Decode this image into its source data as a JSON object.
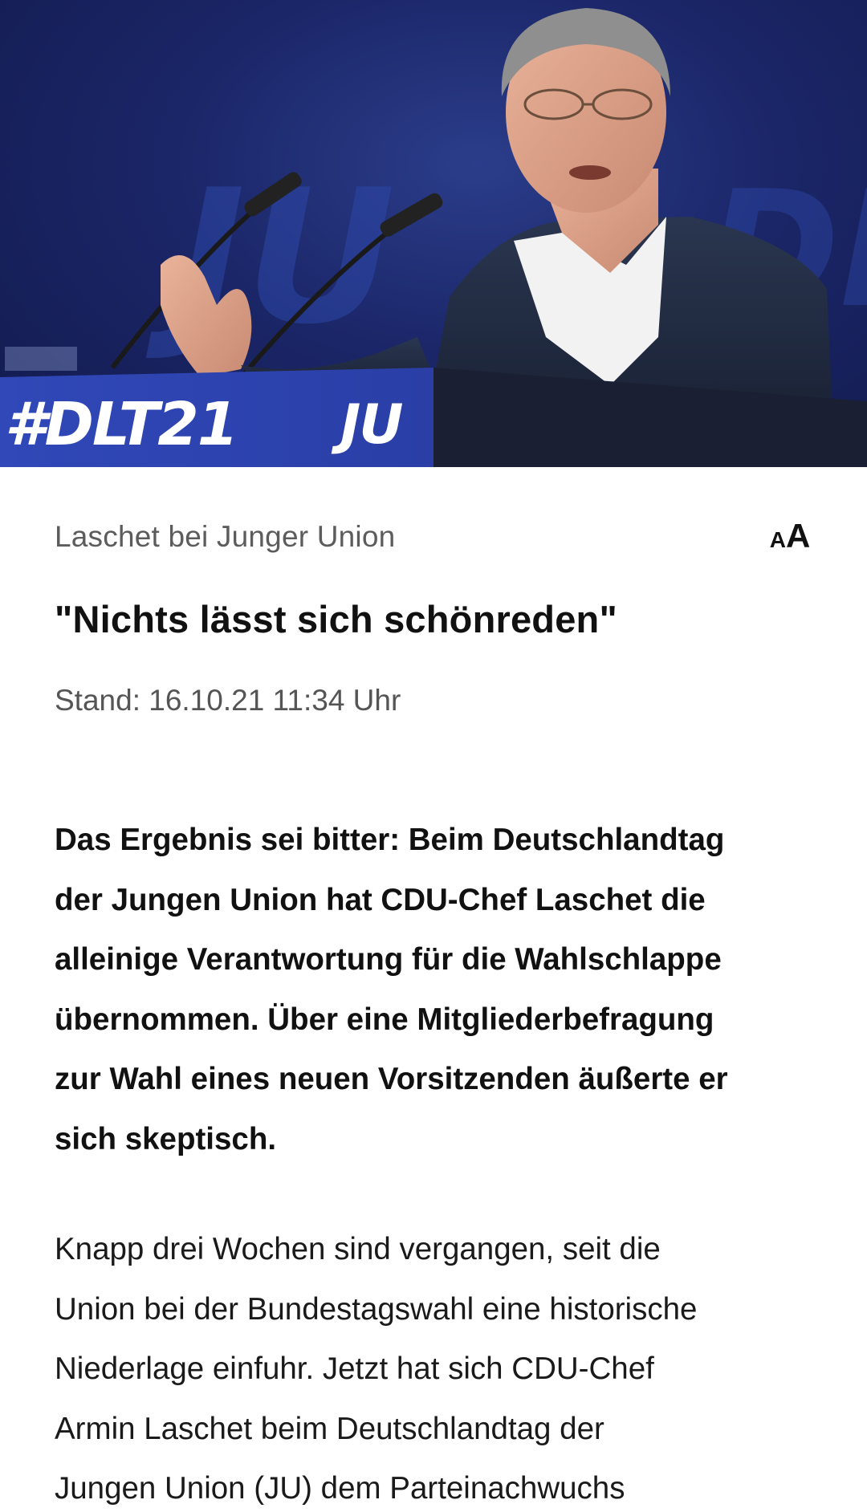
{
  "hero": {
    "lectern_hashtag": "#DLT21",
    "lectern_logo": "JU",
    "backdrop_logo": "JU DLT"
  },
  "article": {
    "topline": "Laschet bei Junger Union",
    "font_size_button": {
      "small": "A",
      "large": "A"
    },
    "headline": "\"Nichts lässt sich schönreden\"",
    "dateline": "Stand: 16.10.21 11:34 Uhr",
    "teaser_lines": [
      "Das Ergebnis sei bitter: Beim Deutschlandtag",
      "der Jungen Union hat CDU-Chef Laschet die",
      "alleinige Verantwortung für die Wahlschlappe",
      "übernommen. Über eine Mitgliederbefragung",
      "zur Wahl eines neuen Vorsitzenden äußerte er",
      "sich skeptisch."
    ],
    "body_lines": [
      "Knapp drei Wochen sind vergangen, seit die",
      "Union bei der Bundestagswahl eine historische",
      "Niederlage einfuhr. Jetzt hat sich CDU-Chef",
      "Armin Laschet beim Deutschlandtag der",
      "Jungen Union (JU) dem Parteinachwuchs"
    ]
  }
}
